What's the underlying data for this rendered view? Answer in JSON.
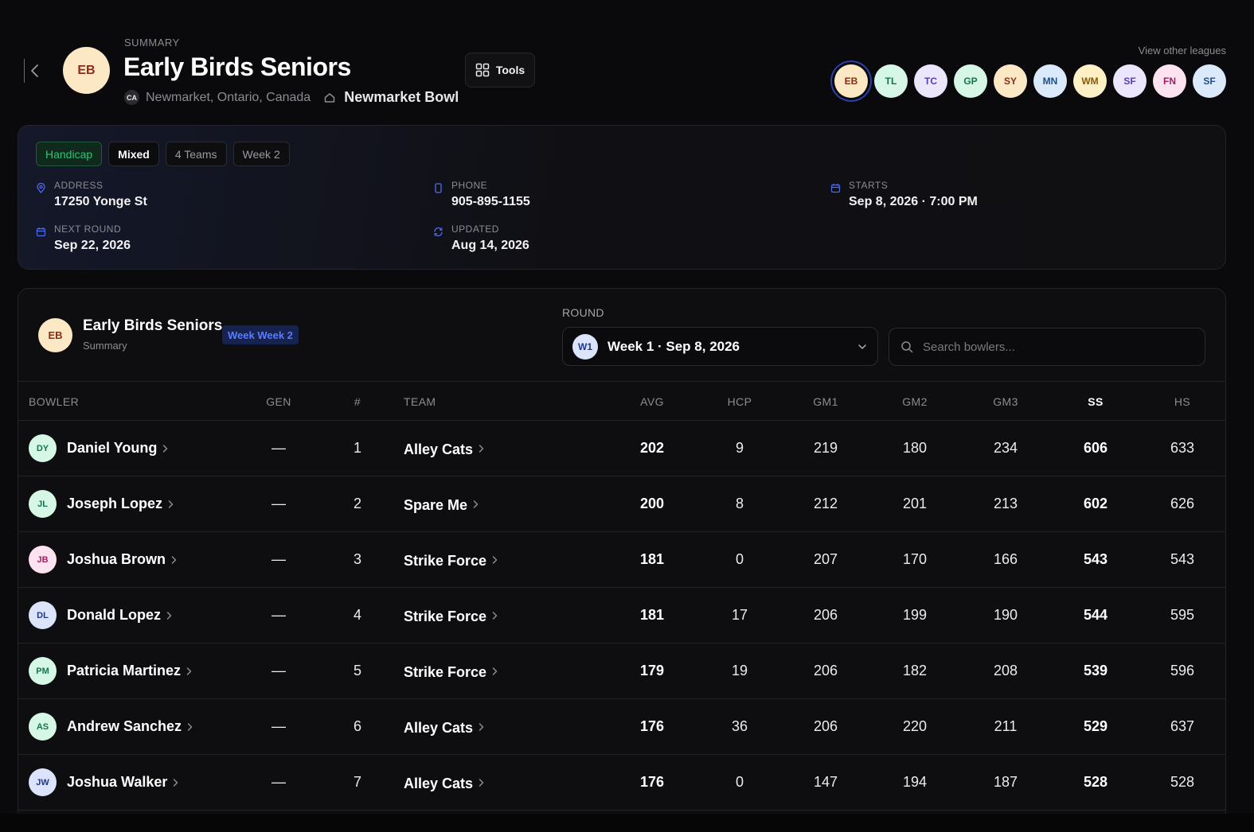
{
  "header": {
    "eyebrow": "SUMMARY",
    "title": "Early Birds Seniors",
    "initials": "EB",
    "country_code": "CA",
    "location": "Newmarket, Ontario, Canada",
    "alley": "Newmarket Bowl",
    "tools_label": "Tools",
    "other_leagues_label": "View other leagues",
    "other_leagues": [
      {
        "initials": "EB",
        "bg": "#fde8c6",
        "fg": "#8a2d14",
        "active": true
      },
      {
        "initials": "TL",
        "bg": "#d6f7e6",
        "fg": "#17744a"
      },
      {
        "initials": "TC",
        "bg": "#ece6fd",
        "fg": "#5b3bb8"
      },
      {
        "initials": "GP",
        "bg": "#d6f7e6",
        "fg": "#17744a"
      },
      {
        "initials": "SY",
        "bg": "#fde8c6",
        "fg": "#8a2d14"
      },
      {
        "initials": "MN",
        "bg": "#dbeafb",
        "fg": "#1d4f8a"
      },
      {
        "initials": "WM",
        "bg": "#fdf0c4",
        "fg": "#8a5a0a"
      },
      {
        "initials": "SF",
        "bg": "#ece6fd",
        "fg": "#5b3bb8"
      },
      {
        "initials": "FN",
        "bg": "#fde2ef",
        "fg": "#a02060"
      },
      {
        "initials": "SF",
        "bg": "#dbeafb",
        "fg": "#1d4f8a"
      }
    ]
  },
  "info": {
    "tags": [
      "Handicap",
      "Mixed",
      "4 Teams",
      "Week 2"
    ],
    "address": {
      "label": "ADDRESS",
      "value": "17250 Yonge St"
    },
    "phone": {
      "label": "PHONE",
      "value": "905-895-1155"
    },
    "starts": {
      "label": "STARTS",
      "value": "Sep 8, 2026 · 7:00 PM"
    },
    "next_round": {
      "label": "NEXT ROUND",
      "value": "Sep 22, 2026"
    },
    "updated": {
      "label": "UPDATED",
      "value": "Aug 14, 2026"
    }
  },
  "panel": {
    "initials": "EB",
    "title": "Early Birds Seniors",
    "subtitle": "Summary",
    "week_badge": "Week Week 2",
    "round_label": "ROUND",
    "round_chip": "W1",
    "round_value": "Week 1 · Sep 8, 2026",
    "search_placeholder": "Search bowlers..."
  },
  "table": {
    "columns": {
      "bowler": "BOWLER",
      "gen": "GEN",
      "num": "#",
      "team": "TEAM",
      "avg": "AVG",
      "hcp": "HCP",
      "gm1": "GM1",
      "gm2": "GM2",
      "gm3": "GM3",
      "ss": "SS",
      "hs": "HS"
    },
    "rows": [
      {
        "initials": "DY",
        "bg": "#d6f7e6",
        "fg": "#17744a",
        "name": "Daniel Young",
        "gen": "—",
        "num": "1",
        "team": "Alley Cats",
        "avg": "202",
        "hcp": "9",
        "gm1": "219",
        "gm2": "180",
        "gm3": "234",
        "ss": "606",
        "hs": "633"
      },
      {
        "initials": "JL",
        "bg": "#d6f7e6",
        "fg": "#17744a",
        "name": "Joseph Lopez",
        "gen": "—",
        "num": "2",
        "team": "Spare Me",
        "avg": "200",
        "hcp": "8",
        "gm1": "212",
        "gm2": "201",
        "gm3": "213",
        "ss": "602",
        "hs": "626"
      },
      {
        "initials": "JB",
        "bg": "#fde2ef",
        "fg": "#a02060",
        "name": "Joshua Brown",
        "gen": "—",
        "num": "3",
        "team": "Strike Force",
        "avg": "181",
        "hcp": "0",
        "gm1": "207",
        "gm2": "170",
        "gm3": "166",
        "ss": "543",
        "hs": "543"
      },
      {
        "initials": "DL",
        "bg": "#dbe4fb",
        "fg": "#1d3a8a",
        "name": "Donald Lopez",
        "gen": "—",
        "num": "4",
        "team": "Strike Force",
        "avg": "181",
        "hcp": "17",
        "gm1": "206",
        "gm2": "199",
        "gm3": "190",
        "ss": "544",
        "hs": "595"
      },
      {
        "initials": "PM",
        "bg": "#d6f7e6",
        "fg": "#17744a",
        "name": "Patricia Martinez",
        "gen": "—",
        "num": "5",
        "team": "Strike Force",
        "avg": "179",
        "hcp": "19",
        "gm1": "206",
        "gm2": "182",
        "gm3": "208",
        "ss": "539",
        "hs": "596"
      },
      {
        "initials": "AS",
        "bg": "#d6f7e6",
        "fg": "#17744a",
        "name": "Andrew Sanchez",
        "gen": "—",
        "num": "6",
        "team": "Alley Cats",
        "avg": "176",
        "hcp": "36",
        "gm1": "206",
        "gm2": "220",
        "gm3": "211",
        "ss": "529",
        "hs": "637"
      },
      {
        "initials": "JW",
        "bg": "#dbe4fb",
        "fg": "#1d3a8a",
        "name": "Joshua Walker",
        "gen": "—",
        "num": "7",
        "team": "Alley Cats",
        "avg": "176",
        "hcp": "0",
        "gm1": "147",
        "gm2": "194",
        "gm3": "187",
        "ss": "528",
        "hs": "528"
      }
    ]
  }
}
